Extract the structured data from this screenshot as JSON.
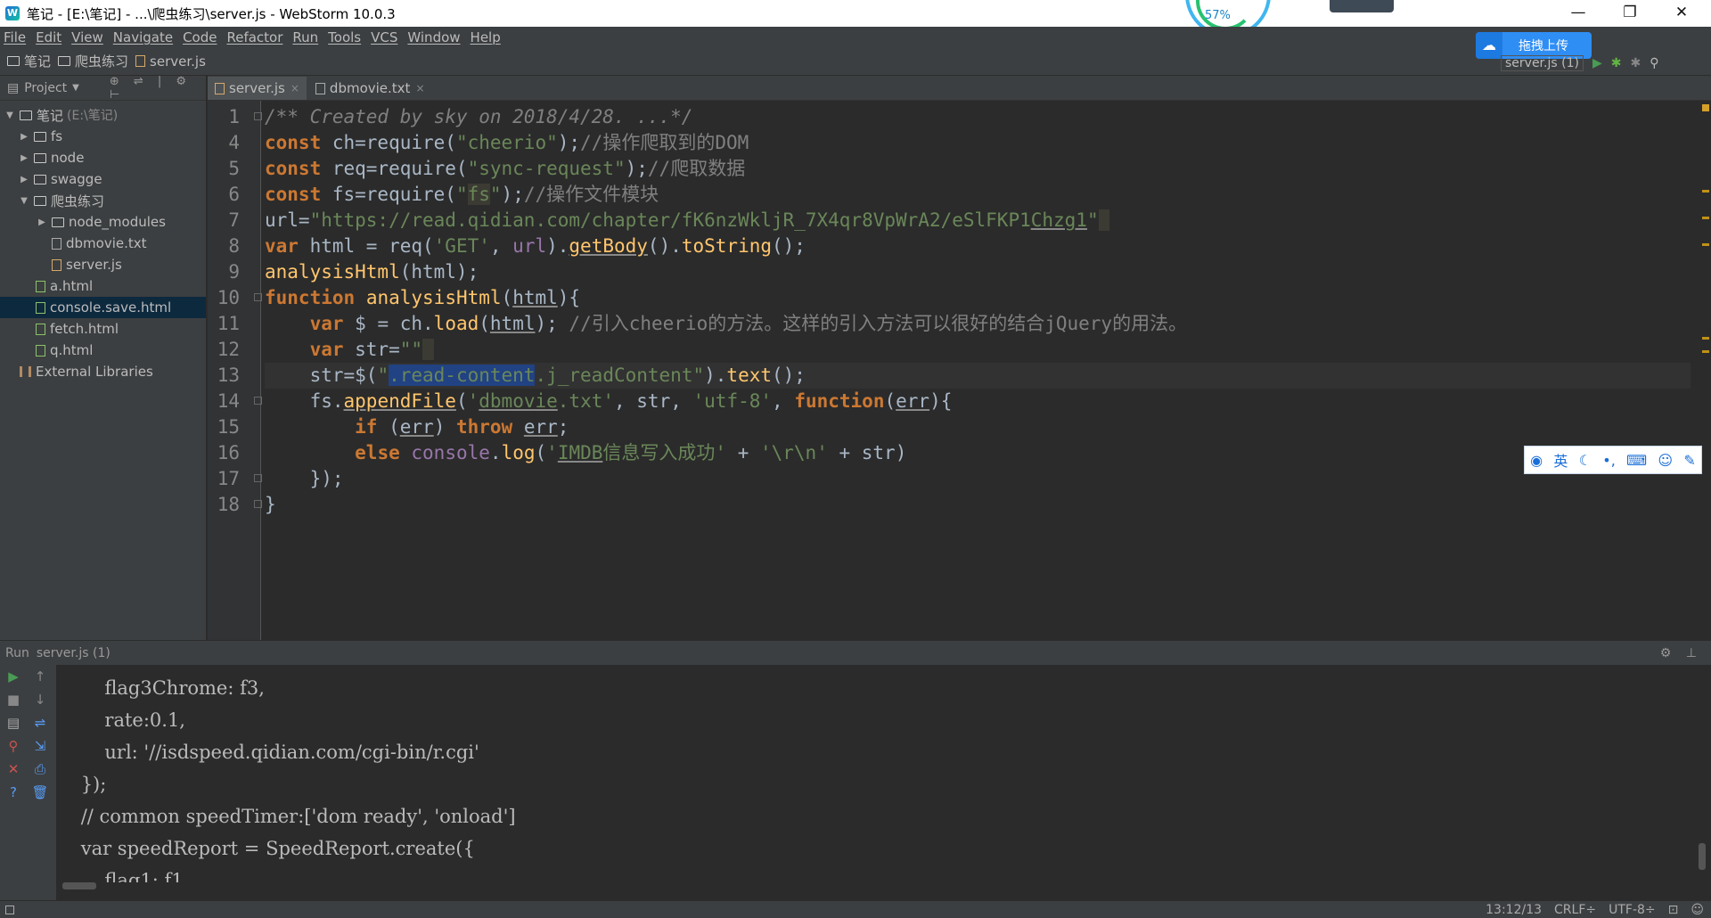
{
  "window": {
    "title": "笔记 - [E:\\笔记] - ...\\爬虫练习\\server.js - WebStorm 10.0.3",
    "minimize": "—",
    "maximize": "❐",
    "close": "✕",
    "speed_pct": "57%"
  },
  "menu": [
    "File",
    "Edit",
    "View",
    "Navigate",
    "Code",
    "Refactor",
    "Run",
    "Tools",
    "VCS",
    "Window",
    "Help"
  ],
  "breadcrumbs": [
    "笔记",
    "爬虫练习",
    "server.js"
  ],
  "upload_button": "拖拽上传",
  "run_config": "server.js (1)",
  "project": {
    "header": "Project",
    "tree": [
      {
        "label": "笔记",
        "path": "(E:\\笔记)",
        "level": 0,
        "arrow": "▼",
        "type": "folder"
      },
      {
        "label": "fs",
        "level": 1,
        "arrow": "▶",
        "type": "folder"
      },
      {
        "label": "node",
        "level": 1,
        "arrow": "▶",
        "type": "folder"
      },
      {
        "label": "swagge",
        "level": 1,
        "arrow": "▶",
        "type": "folder"
      },
      {
        "label": "爬虫练习",
        "level": 1,
        "arrow": "▼",
        "type": "folder"
      },
      {
        "label": "node_modules",
        "level": 2,
        "arrow": "▶",
        "type": "folder"
      },
      {
        "label": "dbmovie.txt",
        "level": 2,
        "arrow": "",
        "type": "txt"
      },
      {
        "label": "server.js",
        "level": 2,
        "arrow": "",
        "type": "js"
      },
      {
        "label": "a.html",
        "level": 1,
        "arrow": "",
        "type": "html"
      },
      {
        "label": "console.save.html",
        "level": 1,
        "arrow": "",
        "type": "html",
        "selected": true
      },
      {
        "label": "fetch.html",
        "level": 1,
        "arrow": "",
        "type": "html"
      },
      {
        "label": "q.html",
        "level": 1,
        "arrow": "",
        "type": "html"
      },
      {
        "label": "External Libraries",
        "level": 0,
        "arrow": "",
        "type": "lib"
      }
    ]
  },
  "tabs": [
    {
      "label": "server.js",
      "active": true
    },
    {
      "label": "dbmovie.txt",
      "active": false
    }
  ],
  "editor": {
    "line_numbers": [
      "1",
      "4",
      "5",
      "6",
      "7",
      "8",
      "9",
      "10",
      "11",
      "12",
      "13",
      "14",
      "15",
      "16",
      "17",
      "18"
    ],
    "cursor_line": "13"
  },
  "run_panel": {
    "title": "Run",
    "config": "server.js (1)",
    "console_lines": [
      "        flag3Chrome: f3,",
      "        rate:0.1,",
      "        url: '//isdspeed.qidian.com/cgi-bin/r.cgi'",
      "    });",
      "    // common speedTimer:['dom ready', 'onload']",
      "    var speedReport = SpeedReport.create({",
      "        flag1: f1,"
    ]
  },
  "ime": {
    "lang": "英"
  },
  "status": {
    "position": "13:12/13",
    "line_sep": "CRLF÷",
    "encoding": "UTF-8÷"
  }
}
